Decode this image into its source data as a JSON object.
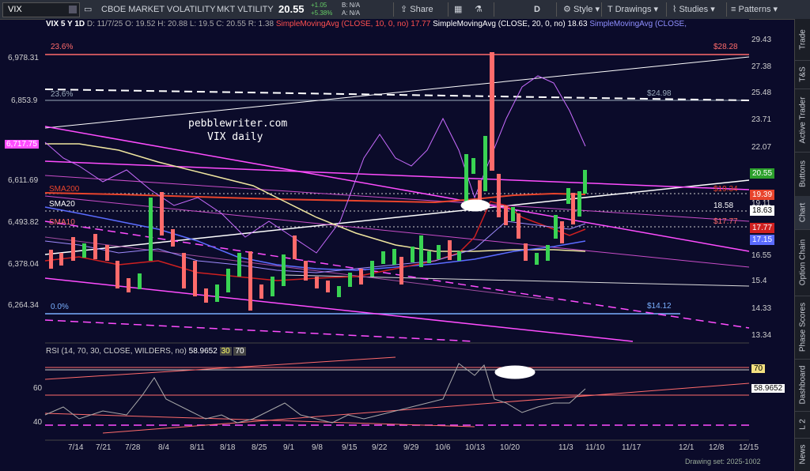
{
  "toolbar": {
    "symbol": "VIX",
    "desc1": "CBOE MARKET VOLATILITY",
    "desc2": "MKT VLTILITY",
    "price": "20.55",
    "change": "+1.05",
    "change_pct": "+5.38%",
    "na1": "N/A",
    "na2": "N/A",
    "share": "Share",
    "period": "D",
    "style": "Style",
    "drawings": "Drawings",
    "studies": "Studies",
    "patterns": "Patterns"
  },
  "header": {
    "title": "VIX 5 Y 1D",
    "d": "D: 11/7/25",
    "o": "O: 19.52",
    "h": "H: 20.88",
    "l": "L: 19.5",
    "c": "C: 20.55",
    "r": "R: 1.38",
    "sma10": "SimpleMovingAvg (CLOSE, 10, 0, no)",
    "sma10_val": "17.77",
    "sma20": "SimpleMovingAvg (CLOSE, 20, 0, no)",
    "sma20_val": "18.63",
    "sma200": "SimpleMovingAvg (CLOSE, "
  },
  "annotations": {
    "site": "pebblewriter.com",
    "sub": "VIX daily",
    "fib_top": "23.6%",
    "fib_mid": "23.6%",
    "fib_zero": "0.0%",
    "val_2828": "$28.28",
    "val_2498": "$24.98",
    "val_1934": "$19.34",
    "val_1777": "$17.77",
    "val_1412": "$14.12",
    "sma200_label": "SMA200",
    "sma20_label": "SMA20",
    "sma10_label": "SMA10",
    "val_1858": "18.58"
  },
  "left_axis": [
    "6,978.31",
    "6,853.9",
    "6,717.75",
    "6,611.69",
    "6,493.82",
    "6,378.04",
    "6,264.34"
  ],
  "right_axis": [
    "29.43",
    "27.38",
    "25.48",
    "23.71",
    "22.07",
    "19.11",
    "16.55",
    "15.4",
    "14.33",
    "13.34"
  ],
  "right_tags": {
    "last": "20.55",
    "sma200": "19.39",
    "sma20": "18.63",
    "sma10": "17.77",
    "other": "17.15"
  },
  "rsi": {
    "header": "RSI (14, 70, 30, CLOSE, WILDERS, no)",
    "val": "58.9652",
    "p30": "30",
    "p70": "70",
    "tag70": "70",
    "tag_val": "58.9652",
    "y60": "60",
    "y40": "40"
  },
  "x_labels": [
    "7/14",
    "7/21",
    "7/28",
    "8/4",
    "8/11",
    "8/18",
    "8/25",
    "9/1",
    "9/8",
    "9/15",
    "9/22",
    "9/29",
    "10/6",
    "10/13",
    "10/20",
    "11/3",
    "11/10",
    "11/17",
    "12/1",
    "12/8",
    "12/15"
  ],
  "footer": {
    "drawing_set": "Drawing set: 2025-1002"
  },
  "sidebar": [
    "Trade",
    "T&S",
    "Active Trader",
    "Buttons",
    "Chart",
    "Option Chain",
    "Phase Scores",
    "Dashboard",
    "L 2",
    "News"
  ],
  "colors": {
    "bg": "#0b0b2a",
    "up": "#39d353",
    "down": "#ff6b6b",
    "magenta": "#ff4dff",
    "sma200": "#e8442c"
  }
}
